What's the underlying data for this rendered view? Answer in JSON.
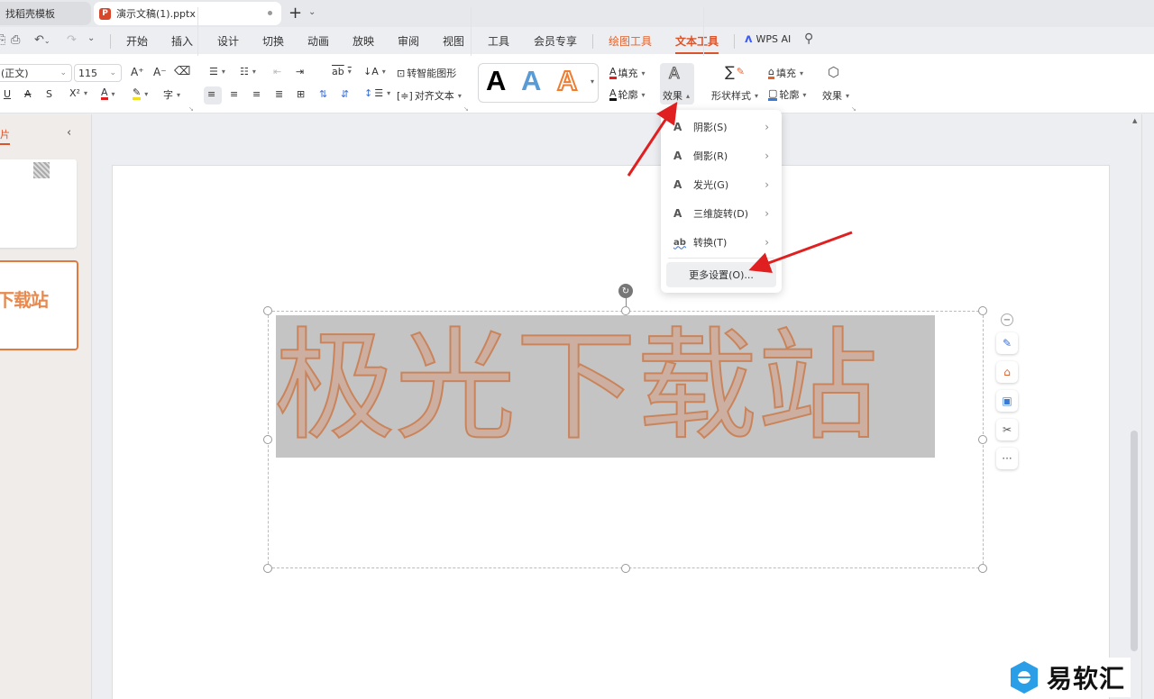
{
  "tabs": [
    {
      "label": "找稻壳模板",
      "icon": "docer-icon"
    },
    {
      "label": "演示文稿(1).pptx",
      "icon": "P",
      "unsaved": true
    }
  ],
  "new_tab_label": "+",
  "menubar": {
    "items": [
      "开始",
      "插入",
      "设计",
      "切换",
      "动画",
      "放映",
      "审阅",
      "视图",
      "工具",
      "会员专享"
    ],
    "context_tabs": [
      "绘图工具",
      "文本工具"
    ],
    "active": "文本工具",
    "wps_ai": "WPS AI"
  },
  "ribbon": {
    "font_name": "(正文)",
    "font_size": "115",
    "insert_smart_shape": "转智能图形",
    "align_text": "对齐文本",
    "text_fill": "填充",
    "text_outline": "轮廓",
    "text_effect": "效果",
    "shape_style": "形状样式",
    "shape_fill": "填充",
    "shape_outline": "轮廓",
    "shape_effect": "效果",
    "wordart_letter": "A",
    "colors": {
      "font_red": "#e02020",
      "highlight_yellow": "#f0e020",
      "accent": "#d9542a",
      "wordart_blue": "#5b9bd5",
      "wordart_orange": "#ed7d31"
    }
  },
  "left_panel": {
    "title": "幻灯片",
    "slide2_text": "下载站"
  },
  "slide": {
    "text": "极光下载站"
  },
  "dropdown": {
    "items": [
      {
        "label": "阴影(S)",
        "icon": "A"
      },
      {
        "label": "倒影(R)",
        "icon": "A"
      },
      {
        "label": "发光(G)",
        "icon": "A"
      },
      {
        "label": "三维旋转(D)",
        "icon": "A"
      },
      {
        "label": "转换(T)",
        "icon": "ab"
      }
    ],
    "more": "更多设置(O)..."
  },
  "float_tools": [
    "minus",
    "brush",
    "fill",
    "outline",
    "tools",
    "more"
  ],
  "more_label": "···",
  "watermark": "易软汇"
}
